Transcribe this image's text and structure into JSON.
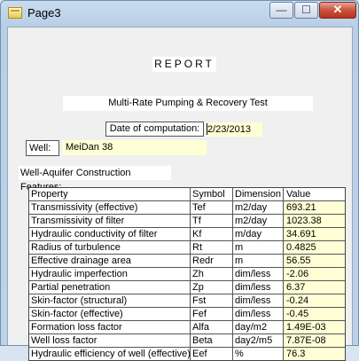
{
  "window": {
    "title": "Page3",
    "minimize": "—",
    "maximize": "☐",
    "close": "✕"
  },
  "report": {
    "heading": "REPORT",
    "title": "Multi-Rate Pumping & Recovery Test",
    "date_label": "Date of computation:",
    "date_value": "2/23/2013",
    "well_label": "Well:",
    "well_value": "MeiDan 38",
    "section_label": "Well-Aquifer Construction Features:"
  },
  "table": {
    "headers": [
      "Property",
      "Symbol",
      "Dimension",
      "Value"
    ],
    "rows": [
      [
        "Transmissivity (effective)",
        "Tef",
        "m2/day",
        "693.21"
      ],
      [
        "Transmissivity of filter",
        "Tf",
        "m2/day",
        "1023.38"
      ],
      [
        "Hydraulic conductivity of filter",
        "Kf",
        "m/day",
        "34.691"
      ],
      [
        "Radius of turbulence",
        "Rt",
        "m",
        "0.4825"
      ],
      [
        "Effective drainage area",
        "Redr",
        "m",
        "56.55"
      ],
      [
        "Hydraulic imperfection",
        "Zh",
        "dim/less",
        "-2.06"
      ],
      [
        "Partial penetration",
        "Zp",
        "dim/less",
        "6.37"
      ],
      [
        "Skin-factor (structural)",
        "Fst",
        "dim/less",
        "-0.24"
      ],
      [
        "Skin-factor (effective)",
        "Fef",
        "dim/less",
        "-0.45"
      ],
      [
        "Formation loss factor",
        "Alfa",
        "day/m2",
        "1.49E-03"
      ],
      [
        "Well loss factor",
        "Beta",
        "day2/m5",
        "7.87E-08"
      ],
      [
        "Hydraulic efficiency of well (effective)",
        "Eef",
        "%",
        "76.3"
      ]
    ]
  }
}
